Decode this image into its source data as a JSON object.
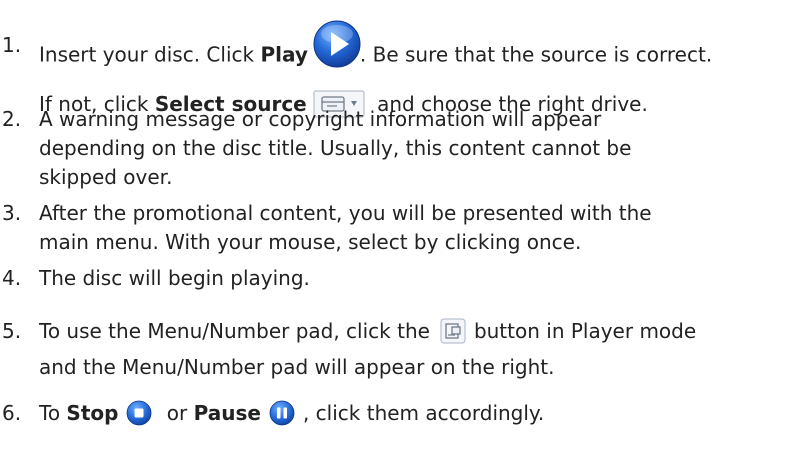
{
  "steps": [
    {
      "number": "1.",
      "line1_pre": "Insert your disc. Click ",
      "line1_bold": "Play",
      "line1_icon": "play-icon",
      "line1_post": ". Be sure that the source is correct.",
      "line2_pre": "If not, click ",
      "line2_bold": "Select source",
      "line2_icon": "select-source-icon",
      "line2_post": " and choose the right drive."
    },
    {
      "number": "2.",
      "lines": [
        "A warning message or copyright information will appear",
        "depending on the disc title. Usually, this content cannot be",
        "skipped over."
      ]
    },
    {
      "number": "3.",
      "lines": [
        "After the promotional content, you will be presented with the",
        "main menu. With your mouse, select by clicking once."
      ]
    },
    {
      "number": "4.",
      "lines": [
        "The disc will begin playing."
      ]
    },
    {
      "number": "5.",
      "line1_pre": "To use the Menu/Number pad, click the",
      "line1_icon": "menu-number-pad-icon",
      "line1_post": "button in Player mode",
      "line2": "and the Menu/Number pad will appear on the right."
    },
    {
      "number": "6.",
      "pre": "To ",
      "stop_label": "Stop",
      "stop_icon": "stop-icon",
      "mid": " or ",
      "pause_label": "Pause",
      "pause_icon": "pause-icon",
      "post": ", click them accordingly."
    }
  ],
  "colors": {
    "text": "#222222",
    "icon_blue": "#1f5fc8",
    "icon_gray_border": "#a9b4c2"
  }
}
